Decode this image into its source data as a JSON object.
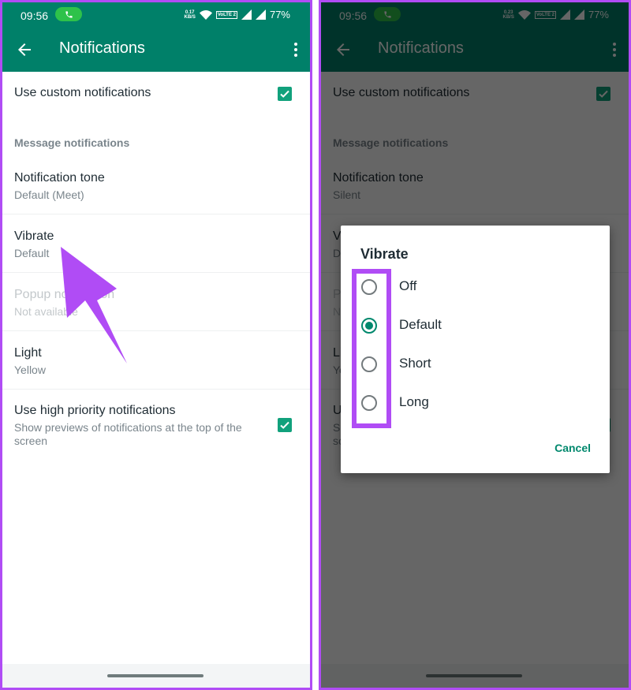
{
  "accent": "#008069",
  "annotation_color": "#b04cf5",
  "left_screen": {
    "statusbar": {
      "time": "09:56",
      "speed_value": "0.17",
      "speed_unit": "KB/S",
      "volte": "VoLTE 2",
      "battery": "77%"
    },
    "appbar": {
      "title": "Notifications"
    },
    "settings": {
      "custom_notifications": {
        "label": "Use custom notifications",
        "checked": true
      },
      "section_header": "Message notifications",
      "notification_tone": {
        "label": "Notification tone",
        "value": "Default (Meet)"
      },
      "vibrate": {
        "label": "Vibrate",
        "value": "Default"
      },
      "popup": {
        "label": "Popup notification",
        "value": "Not available"
      },
      "light": {
        "label": "Light",
        "value": "Yellow"
      },
      "high_priority": {
        "label": "Use high priority notifications",
        "description": "Show previews of notifications at the top of the screen",
        "checked": true
      }
    }
  },
  "right_screen": {
    "statusbar": {
      "time": "09:56",
      "speed_value": "0.23",
      "speed_unit": "KB/S",
      "volte": "VoLTE 2",
      "battery": "77%"
    },
    "appbar": {
      "title": "Notifications"
    },
    "settings": {
      "custom_notifications": {
        "label": "Use custom notifications",
        "checked": true
      },
      "section_header": "Message notifications",
      "notification_tone": {
        "label": "Notification tone",
        "value": "Silent"
      },
      "vibrate": {
        "label": "Vibrate",
        "value": "Default"
      },
      "popup": {
        "label": "Popup notification",
        "value": "Not available"
      },
      "light": {
        "label": "Light",
        "value": "Yellow"
      },
      "high_priority": {
        "label": "Use high priority notifications",
        "description": "Show previews of notifications at the top of the screen",
        "checked": true
      }
    },
    "dialog": {
      "title": "Vibrate",
      "options": [
        {
          "label": "Off",
          "selected": false
        },
        {
          "label": "Default",
          "selected": true
        },
        {
          "label": "Short",
          "selected": false
        },
        {
          "label": "Long",
          "selected": false
        }
      ],
      "cancel_label": "Cancel"
    }
  }
}
